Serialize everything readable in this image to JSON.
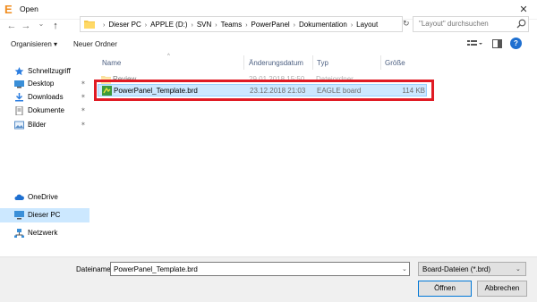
{
  "window": {
    "title": "Open",
    "app_icon": "E",
    "close_glyph": "✕"
  },
  "nav_buttons": {
    "back": "←",
    "forward": "→",
    "up_chevron": "⌄",
    "up": "↑"
  },
  "address": {
    "crumbs": [
      "Dieser PC",
      "APPLE (D:)",
      "SVN",
      "Teams",
      "PowerPanel",
      "Dokumentation",
      "Layout"
    ],
    "separator": "›",
    "dropdown": "⌄",
    "refresh": "↻"
  },
  "search": {
    "placeholder": "\"Layout\" durchsuchen"
  },
  "toolbar": {
    "organize": "Organisieren ▾",
    "new_folder": "Neuer Ordner",
    "help": "?"
  },
  "sidebar": {
    "items": [
      {
        "label": "Schnellzugriff",
        "icon": "star-icon"
      },
      {
        "label": "Desktop",
        "icon": "desktop-icon",
        "pinned": true
      },
      {
        "label": "Downloads",
        "icon": "download-icon",
        "pinned": true
      },
      {
        "label": "Dokumente",
        "icon": "documents-icon",
        "pinned": true
      },
      {
        "label": "Bilder",
        "icon": "pictures-icon",
        "pinned": true
      },
      {
        "label": "OneDrive",
        "icon": "cloud-icon"
      },
      {
        "label": "Dieser PC",
        "icon": "pc-icon",
        "selected": true
      },
      {
        "label": "Netzwerk",
        "icon": "network-icon"
      }
    ],
    "pin_glyph": "📌"
  },
  "columns": {
    "name": "Name",
    "date": "Änderungsdatum",
    "type": "Typ",
    "size": "Größe"
  },
  "files": [
    {
      "name": "Review",
      "date": "29.01.2018 15:50",
      "type": "Dateiordner",
      "size": ""
    },
    {
      "name": "PowerPanel_Template.brd",
      "date": "23.12.2018 21:03",
      "type": "EAGLE board",
      "size": "114 KB"
    }
  ],
  "footer": {
    "filename_label": "Dateiname:",
    "filename_value": "PowerPanel_Template.brd",
    "filetype": "Board-Dateien (*.brd)",
    "open": "Öffnen",
    "cancel": "Abbrechen"
  },
  "colors": {
    "selection": "#cce8ff",
    "highlight_box": "#e01b24",
    "app_icon": "#f08c1e"
  }
}
